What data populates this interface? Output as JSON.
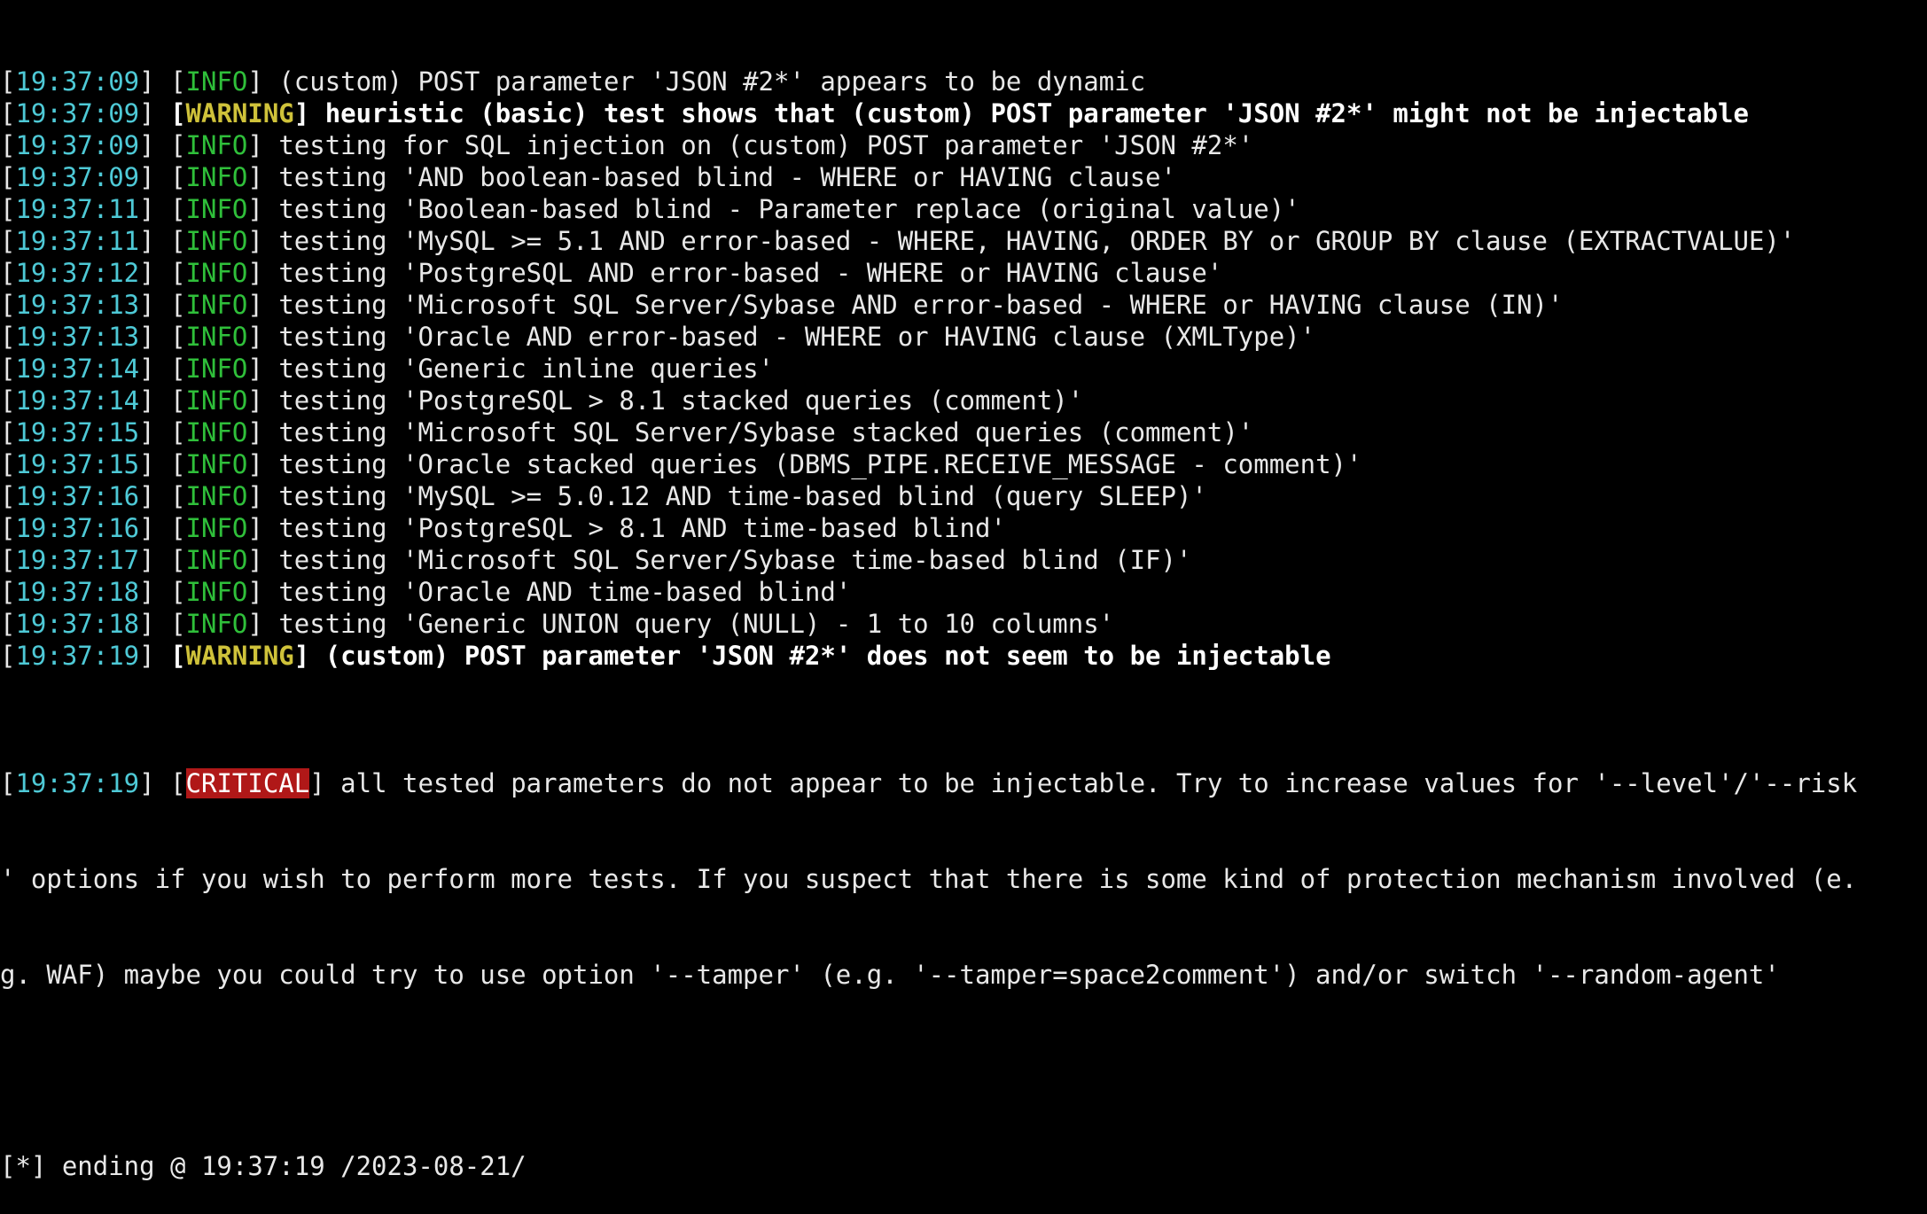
{
  "colors": {
    "background": "#000000",
    "text": "#e8e8e8",
    "timestamp": "#4ec9d6",
    "info": "#2fbf3a",
    "warning": "#cfc23a",
    "critical_bg": "#b01818"
  },
  "log": [
    {
      "time": "19:37:09",
      "level": "INFO",
      "msg": "(custom) POST parameter 'JSON #2*' appears to be dynamic"
    },
    {
      "time": "19:37:09",
      "level": "WARNING",
      "msg": "heuristic (basic) test shows that (custom) POST parameter 'JSON #2*' might not be injectable"
    },
    {
      "time": "19:37:09",
      "level": "INFO",
      "msg": "testing for SQL injection on (custom) POST parameter 'JSON #2*'"
    },
    {
      "time": "19:37:09",
      "level": "INFO",
      "msg": "testing 'AND boolean-based blind - WHERE or HAVING clause'"
    },
    {
      "time": "19:37:11",
      "level": "INFO",
      "msg": "testing 'Boolean-based blind - Parameter replace (original value)'"
    },
    {
      "time": "19:37:11",
      "level": "INFO",
      "msg": "testing 'MySQL >= 5.1 AND error-based - WHERE, HAVING, ORDER BY or GROUP BY clause (EXTRACTVALUE)'"
    },
    {
      "time": "19:37:12",
      "level": "INFO",
      "msg": "testing 'PostgreSQL AND error-based - WHERE or HAVING clause'"
    },
    {
      "time": "19:37:13",
      "level": "INFO",
      "msg": "testing 'Microsoft SQL Server/Sybase AND error-based - WHERE or HAVING clause (IN)'"
    },
    {
      "time": "19:37:13",
      "level": "INFO",
      "msg": "testing 'Oracle AND error-based - WHERE or HAVING clause (XMLType)'"
    },
    {
      "time": "19:37:14",
      "level": "INFO",
      "msg": "testing 'Generic inline queries'"
    },
    {
      "time": "19:37:14",
      "level": "INFO",
      "msg": "testing 'PostgreSQL > 8.1 stacked queries (comment)'"
    },
    {
      "time": "19:37:15",
      "level": "INFO",
      "msg": "testing 'Microsoft SQL Server/Sybase stacked queries (comment)'"
    },
    {
      "time": "19:37:15",
      "level": "INFO",
      "msg": "testing 'Oracle stacked queries (DBMS_PIPE.RECEIVE_MESSAGE - comment)'"
    },
    {
      "time": "19:37:16",
      "level": "INFO",
      "msg": "testing 'MySQL >= 5.0.12 AND time-based blind (query SLEEP)'"
    },
    {
      "time": "19:37:16",
      "level": "INFO",
      "msg": "testing 'PostgreSQL > 8.1 AND time-based blind'"
    },
    {
      "time": "19:37:17",
      "level": "INFO",
      "msg": "testing 'Microsoft SQL Server/Sybase time-based blind (IF)'"
    },
    {
      "time": "19:37:18",
      "level": "INFO",
      "msg": "testing 'Oracle AND time-based blind'"
    },
    {
      "time": "19:37:18",
      "level": "INFO",
      "msg": "testing 'Generic UNION query (NULL) - 1 to 10 columns'"
    },
    {
      "time": "19:37:19",
      "level": "WARNING",
      "msg": "(custom) POST parameter 'JSON #2*' does not seem to be injectable"
    }
  ],
  "critical": {
    "time": "19:37:19",
    "level": "CRITICAL",
    "line1": "all tested parameters do not appear to be injectable. Try to increase values for '--level'/'--risk",
    "line2": "' options if you wish to perform more tests. If you suspect that there is some kind of protection mechanism involved (e.",
    "line3": "g. WAF) maybe you could try to use option '--tamper' (e.g. '--tamper=space2comment') and/or switch '--random-agent'"
  },
  "ending": "[*] ending @ 19:37:19 /2023-08-21/"
}
